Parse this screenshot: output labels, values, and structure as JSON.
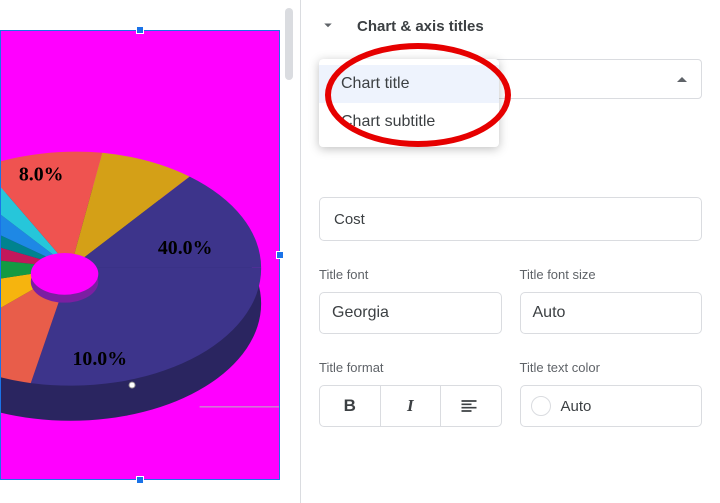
{
  "section_title": "Chart & axis titles",
  "title_type": {
    "selected": "Chart title",
    "options": [
      "Chart title",
      "Chart subtitle"
    ]
  },
  "title_text_field": {
    "value": "Cost"
  },
  "title_font": {
    "label": "Title font",
    "value": "Georgia"
  },
  "title_font_size": {
    "label": "Title font size",
    "value": "Auto"
  },
  "title_format": {
    "label": "Title format",
    "bold": "B",
    "italic": "I"
  },
  "title_text_color": {
    "label": "Title text color",
    "value": "Auto"
  },
  "chart_data": {
    "type": "pie",
    "style": "3d-donut",
    "background": "#ff00ff",
    "slices": [
      {
        "label": "40.0%",
        "value": 40.0,
        "color": "#3d348b"
      },
      {
        "label": "10.0%",
        "value": 10.0,
        "color": "#e85d4a"
      },
      {
        "label": "",
        "value": 9.0,
        "color": "#f6b40e"
      },
      {
        "label": "",
        "value": 8.0,
        "color": "#139a43"
      },
      {
        "label": "",
        "value": 7.0,
        "color": "#c2185b"
      },
      {
        "label": "",
        "value": 3.0,
        "color": "#00838f"
      },
      {
        "label": "",
        "value": 4.0,
        "color": "#1e88e5"
      },
      {
        "label": "",
        "value": 3.0,
        "color": "#8e24aa"
      },
      {
        "label": "",
        "value": 4.0,
        "color": "#26c6da"
      },
      {
        "label": "8.0%",
        "value": 8.0,
        "color": "#ef5350"
      },
      {
        "label": "",
        "value": 4.0,
        "color": "#d4a017"
      }
    ],
    "visible_labels": {
      "a": "8.0%",
      "b": "40.0%",
      "c": "10.0%"
    }
  }
}
